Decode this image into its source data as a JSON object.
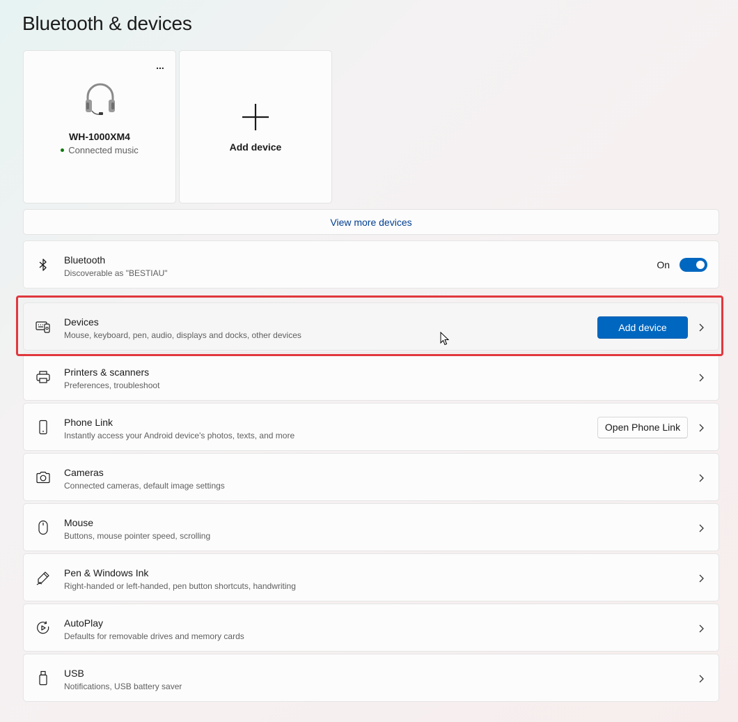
{
  "page": {
    "title": "Bluetooth & devices"
  },
  "device_tile": {
    "name": "WH-1000XM4",
    "status": "Connected music",
    "more_label": "...",
    "icon": "headset-icon"
  },
  "add_tile": {
    "label": "Add device",
    "icon": "plus-icon"
  },
  "view_more": {
    "label": "View more devices"
  },
  "bluetooth": {
    "title": "Bluetooth",
    "subtitle": "Discoverable as \"BESTIAU\"",
    "state_label": "On",
    "enabled": true,
    "icon": "bluetooth-icon"
  },
  "rows": [
    {
      "title": "Devices",
      "subtitle": "Mouse, keyboard, pen, audio, displays and docks, other devices",
      "button": "Add device",
      "icon": "devices-icon"
    },
    {
      "title": "Printers & scanners",
      "subtitle": "Preferences, troubleshoot",
      "icon": "printer-icon"
    },
    {
      "title": "Phone Link",
      "subtitle": "Instantly access your Android device's photos, texts, and more",
      "button": "Open Phone Link",
      "icon": "phone-icon"
    },
    {
      "title": "Cameras",
      "subtitle": "Connected cameras, default image settings",
      "icon": "camera-icon"
    },
    {
      "title": "Mouse",
      "subtitle": "Buttons, mouse pointer speed, scrolling",
      "icon": "mouse-icon"
    },
    {
      "title": "Pen & Windows Ink",
      "subtitle": "Right-handed or left-handed, pen button shortcuts, handwriting",
      "icon": "pen-icon"
    },
    {
      "title": "AutoPlay",
      "subtitle": "Defaults for removable drives and memory cards",
      "icon": "autoplay-icon"
    },
    {
      "title": "USB",
      "subtitle": "Notifications, USB battery saver",
      "icon": "usb-icon"
    }
  ],
  "colors": {
    "accent": "#0067c0",
    "highlight_border": "#e0383e",
    "link": "#003e92",
    "status_dot": "#0f7b0f"
  }
}
